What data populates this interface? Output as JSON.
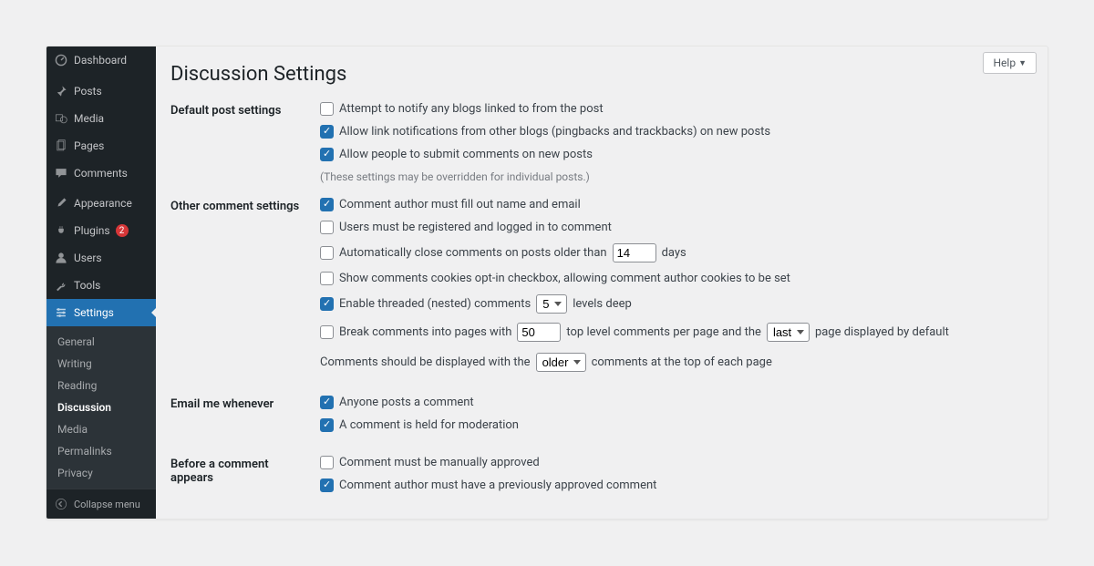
{
  "header": {
    "help_label": "Help"
  },
  "page_title": "Discussion Settings",
  "sidebar": {
    "items": [
      {
        "label": "Dashboard"
      },
      {
        "label": "Posts"
      },
      {
        "label": "Media"
      },
      {
        "label": "Pages"
      },
      {
        "label": "Comments"
      },
      {
        "label": "Appearance"
      },
      {
        "label": "Plugins",
        "badge": "2"
      },
      {
        "label": "Users"
      },
      {
        "label": "Tools"
      },
      {
        "label": "Settings"
      }
    ],
    "submenu": [
      {
        "label": "General"
      },
      {
        "label": "Writing"
      },
      {
        "label": "Reading"
      },
      {
        "label": "Discussion"
      },
      {
        "label": "Media"
      },
      {
        "label": "Permalinks"
      },
      {
        "label": "Privacy"
      }
    ],
    "collapse_label": "Collapse menu"
  },
  "sections": {
    "default_post": {
      "heading": "Default post settings",
      "opt1": "Attempt to notify any blogs linked to from the post",
      "opt2": "Allow link notifications from other blogs (pingbacks and trackbacks) on new posts",
      "opt3": "Allow people to submit comments on new posts",
      "note": "(These settings may be overridden for individual posts.)"
    },
    "other": {
      "heading": "Other comment settings",
      "opt1": "Comment author must fill out name and email",
      "opt2": "Users must be registered and logged in to comment",
      "opt3_pre": "Automatically close comments on posts older than",
      "opt3_days_value": "14",
      "opt3_post": "days",
      "opt4": "Show comments cookies opt-in checkbox, allowing comment author cookies to be set",
      "opt5_pre": "Enable threaded (nested) comments",
      "opt5_depth_value": "5",
      "opt5_post": "levels deep",
      "opt6_pre": "Break comments into pages with",
      "opt6_perpage_value": "50",
      "opt6_mid": "top level comments per page and the",
      "opt6_lastfirst_value": "last",
      "opt6_post": "page displayed by default",
      "order_pre": "Comments should be displayed with the",
      "order_value": "older",
      "order_post": "comments at the top of each page"
    },
    "email": {
      "heading": "Email me whenever",
      "opt1": "Anyone posts a comment",
      "opt2": "A comment is held for moderation"
    },
    "before": {
      "heading": "Before a comment appears",
      "opt1": "Comment must be manually approved",
      "opt2": "Comment author must have a previously approved comment"
    }
  }
}
